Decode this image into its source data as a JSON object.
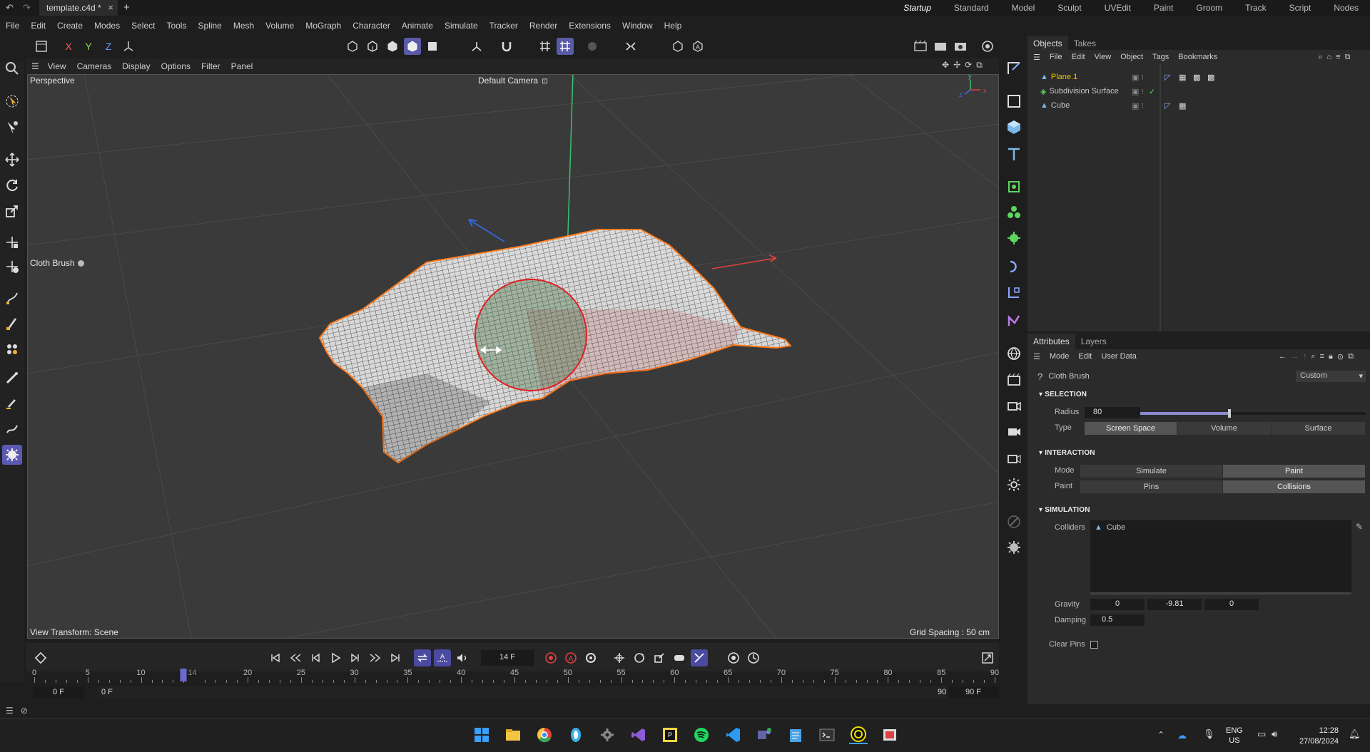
{
  "app": {
    "tab_title": "template.c4d *",
    "layouts": [
      "Startup",
      "Standard",
      "Model",
      "Sculpt",
      "UVEdit",
      "Paint",
      "Groom",
      "Track",
      "Script",
      "Nodes"
    ],
    "active_layout": "Startup"
  },
  "menu": [
    "File",
    "Edit",
    "Create",
    "Modes",
    "Select",
    "Tools",
    "Spline",
    "Mesh",
    "Volume",
    "MoGraph",
    "Character",
    "Animate",
    "Simulate",
    "Tracker",
    "Render",
    "Extensions",
    "Window",
    "Help"
  ],
  "axis_buttons": {
    "x": "X",
    "y": "Y",
    "z": "Z"
  },
  "viewport": {
    "menu": [
      "View",
      "Cameras",
      "Display",
      "Options",
      "Filter",
      "Panel"
    ],
    "label": "Perspective",
    "camera": "Default Camera",
    "brush_label": "Cloth Brush",
    "view_transform": "View Transform: Scene",
    "grid_spacing": "Grid Spacing : 50 cm"
  },
  "timeline": {
    "current_frame": "14 F",
    "ruler_labels": [
      "0",
      "5",
      "10",
      "20",
      "25",
      "30",
      "35",
      "40",
      "45",
      "50",
      "55",
      "60",
      "65",
      "70",
      "75",
      "80",
      "85",
      "90"
    ],
    "playhead_label": "14",
    "start_left": "0 F",
    "start_inner": "0 F",
    "end_inner": "90 F",
    "end_right": "90 F"
  },
  "objects": {
    "tabs": [
      "Objects",
      "Takes"
    ],
    "menu": [
      "File",
      "Edit",
      "View",
      "Object",
      "Tags",
      "Bookmarks"
    ],
    "rows": [
      {
        "name": "Plane.1",
        "color": "#f0c000"
      },
      {
        "name": "Subdivision Surface",
        "color": "#cfcfcf"
      },
      {
        "name": "Cube",
        "color": "#cfcfcf"
      }
    ]
  },
  "attributes": {
    "tabs": [
      "Attributes",
      "Layers"
    ],
    "menu": [
      "Mode",
      "Edit",
      "User Data"
    ],
    "tool_name": "Cloth Brush",
    "preset": "Custom",
    "selection": {
      "header": "SELECTION",
      "radius_label": "Radius",
      "radius_value": "80",
      "radius_fraction": 0.39,
      "type_label": "Type",
      "type_options": [
        "Screen Space",
        "Volume",
        "Surface"
      ],
      "type_selected": "Screen Space"
    },
    "interaction": {
      "header": "INTERACTION",
      "mode_label": "Mode",
      "mode_options": [
        "Simulate",
        "Paint"
      ],
      "mode_selected": "Paint",
      "paint_label": "Paint",
      "paint_options": [
        "Pins",
        "Collisions"
      ],
      "paint_selected": "Collisions"
    },
    "simulation": {
      "header": "SIMULATION",
      "colliders_label": "Colliders",
      "collider_item": "Cube",
      "gravity_label": "Gravity",
      "gravity": [
        "0",
        "-9.81",
        "0"
      ],
      "damping_label": "Damping",
      "damping": "0.5",
      "clear_pins_label": "Clear Pins",
      "clear_pins": false
    }
  },
  "taskbar": {
    "lang": "ENG",
    "region": "US",
    "time": "12:28",
    "date": "27/08/2024"
  },
  "colors": {
    "accent": "#5a5ab4",
    "selection_orange": "#ff7a1a",
    "brush_red": "#e02020"
  }
}
